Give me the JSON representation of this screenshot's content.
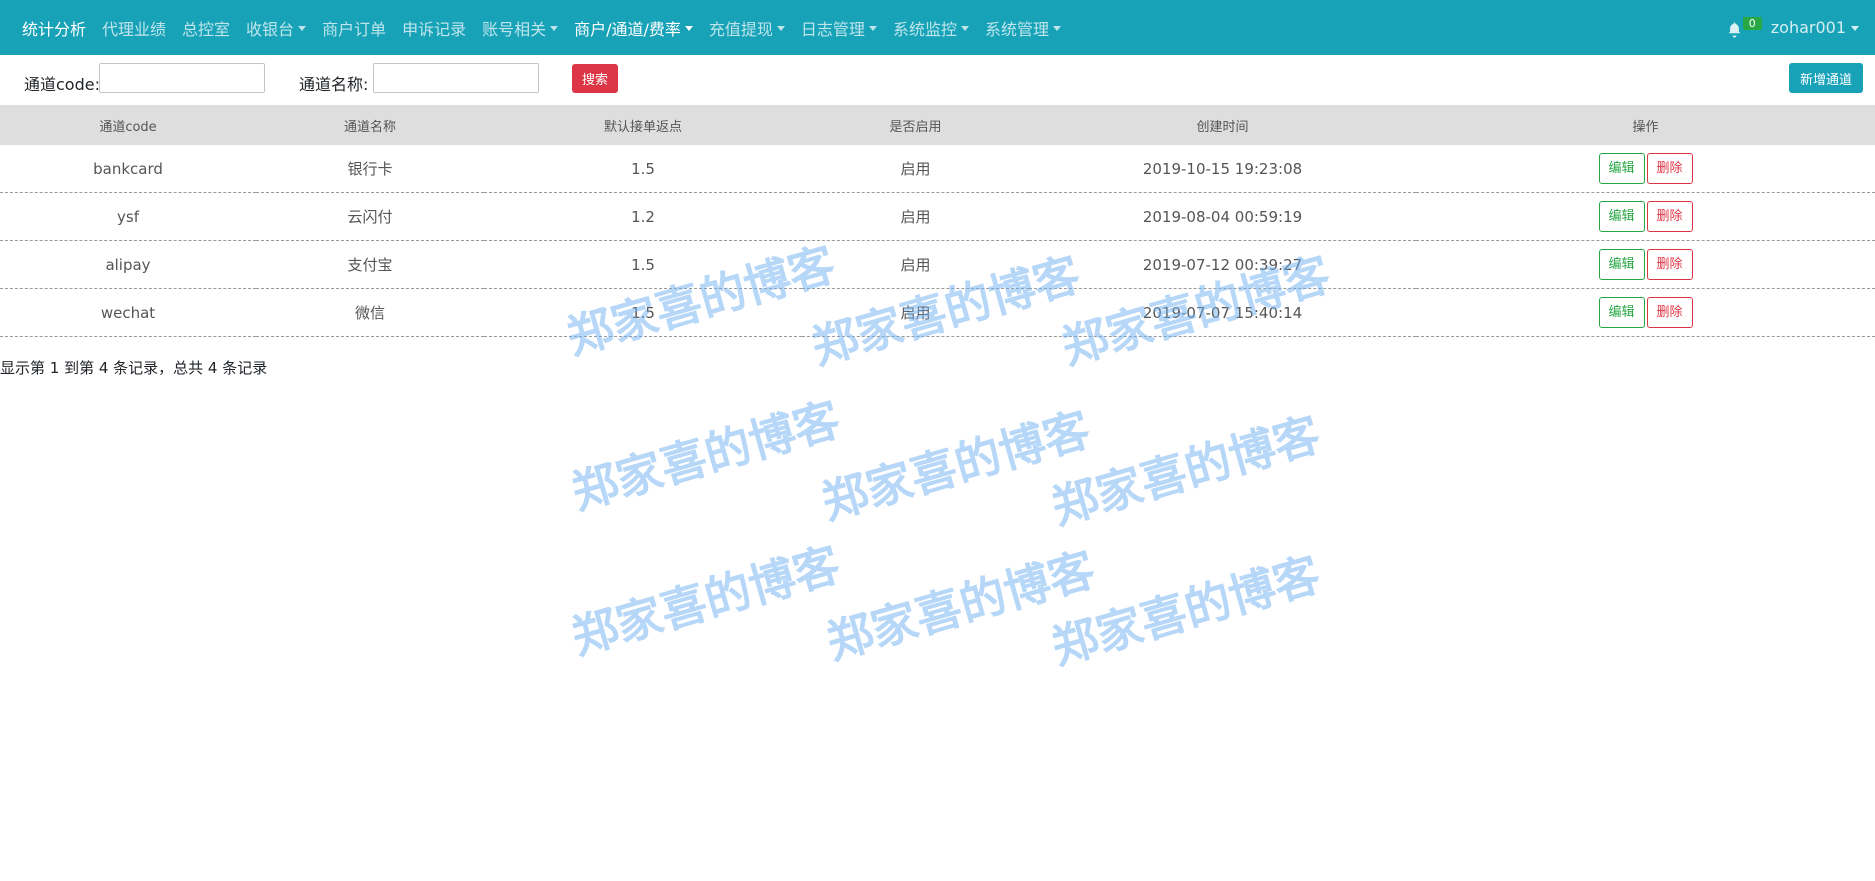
{
  "navbar": {
    "items": [
      {
        "label": "统计分析",
        "dropdown": false,
        "active": true
      },
      {
        "label": "代理业绩",
        "dropdown": false,
        "active": false
      },
      {
        "label": "总控室",
        "dropdown": false,
        "active": false
      },
      {
        "label": "收银台",
        "dropdown": true,
        "active": false
      },
      {
        "label": "商户订单",
        "dropdown": false,
        "active": false
      },
      {
        "label": "申诉记录",
        "dropdown": false,
        "active": false
      },
      {
        "label": "账号相关",
        "dropdown": true,
        "active": false
      },
      {
        "label": "商户/通道/费率",
        "dropdown": true,
        "active": true
      },
      {
        "label": "充值提现",
        "dropdown": true,
        "active": false
      },
      {
        "label": "日志管理",
        "dropdown": true,
        "active": false
      },
      {
        "label": "系统监控",
        "dropdown": true,
        "active": false
      },
      {
        "label": "系统管理",
        "dropdown": true,
        "active": false
      }
    ],
    "notification_icon": "bell-icon",
    "notification_count": "0",
    "username": "zohar001"
  },
  "search": {
    "code_label": "通道code:",
    "code_value": "",
    "name_label": "通道名称:",
    "name_value": "",
    "search_button": "搜索",
    "add_button": "新增通道"
  },
  "table": {
    "headers": [
      "通道code",
      "通道名称",
      "默认接单返点",
      "是否启用",
      "创建时间",
      "操作"
    ],
    "rows": [
      {
        "code": "bankcard",
        "name": "银行卡",
        "rebate": "1.5",
        "enabled": "启用",
        "created": "2019-10-15 19:23:08"
      },
      {
        "code": "ysf",
        "name": "云闪付",
        "rebate": "1.2",
        "enabled": "启用",
        "created": "2019-08-04 00:59:19"
      },
      {
        "code": "alipay",
        "name": "支付宝",
        "rebate": "1.5",
        "enabled": "启用",
        "created": "2019-07-12 00:39:27"
      },
      {
        "code": "wechat",
        "name": "微信",
        "rebate": "1.5",
        "enabled": "启用",
        "created": "2019-07-07 15:40:14"
      }
    ],
    "edit_label": "编辑",
    "delete_label": "删除"
  },
  "pagination": {
    "info": "显示第 1 到第 4 条记录，总共 4 条记录"
  },
  "watermark": {
    "text": "郑家喜的博客"
  },
  "colors": {
    "navbar": "#17a2b8",
    "danger": "#dc3545",
    "success": "#28a745",
    "header_bg": "#dedede"
  }
}
